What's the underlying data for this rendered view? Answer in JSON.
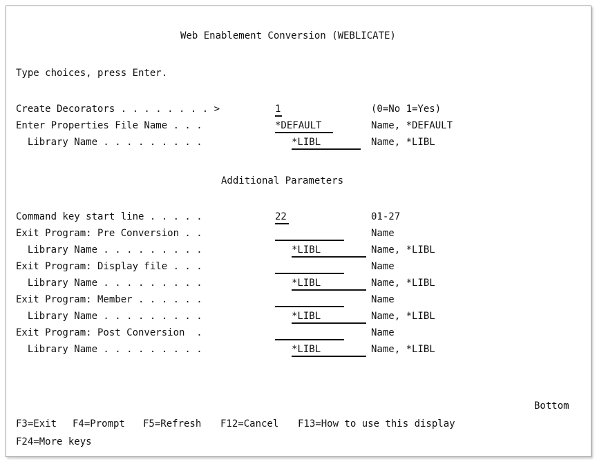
{
  "screen": {
    "title": "Web Enablement Conversion (WEBLICATE)",
    "instruction": "Type choices, press Enter.",
    "section_header": "Additional Parameters",
    "bottom_indicator": "Bottom"
  },
  "fields": {
    "create_decorators": {
      "label": "Create Decorators . . . . . . . . >",
      "value": "1",
      "hint": "(0=No 1=Yes)"
    },
    "properties_file": {
      "label": "Enter Properties File Name . . .",
      "value": "*DEFAULT",
      "hint": "Name, *DEFAULT"
    },
    "properties_library": {
      "label": "  Library Name . . . . . . . . .",
      "value": "*LIBL",
      "hint": "Name, *LIBL"
    },
    "command_key_line": {
      "label": "Command key start line . . . . .",
      "value": "22",
      "hint": "01-27"
    },
    "exit_pre": {
      "label": "Exit Program: Pre Conversion . .",
      "value": "",
      "hint": "Name"
    },
    "exit_pre_library": {
      "label": "  Library Name . . . . . . . . .",
      "value": "*LIBL",
      "hint": "Name, *LIBL"
    },
    "exit_display": {
      "label": "Exit Program: Display file . . .",
      "value": "",
      "hint": "Name"
    },
    "exit_display_library": {
      "label": "  Library Name . . . . . . . . .",
      "value": "*LIBL",
      "hint": "Name, *LIBL"
    },
    "exit_member": {
      "label": "Exit Program: Member . . . . . .",
      "value": "",
      "hint": "Name"
    },
    "exit_member_library": {
      "label": "  Library Name . . . . . . . . .",
      "value": "*LIBL",
      "hint": "Name, *LIBL"
    },
    "exit_post": {
      "label": "Exit Program: Post Conversion  .",
      "value": "",
      "hint": "Name"
    },
    "exit_post_library": {
      "label": "  Library Name . . . . . . . . .",
      "value": "*LIBL",
      "hint": "Name, *LIBL"
    }
  },
  "function_keys": {
    "f3": "F3=Exit",
    "f4": "F4=Prompt",
    "f5": "F5=Refresh",
    "f12": "F12=Cancel",
    "f13": "F13=How to use this display",
    "f24": "F24=More keys"
  }
}
